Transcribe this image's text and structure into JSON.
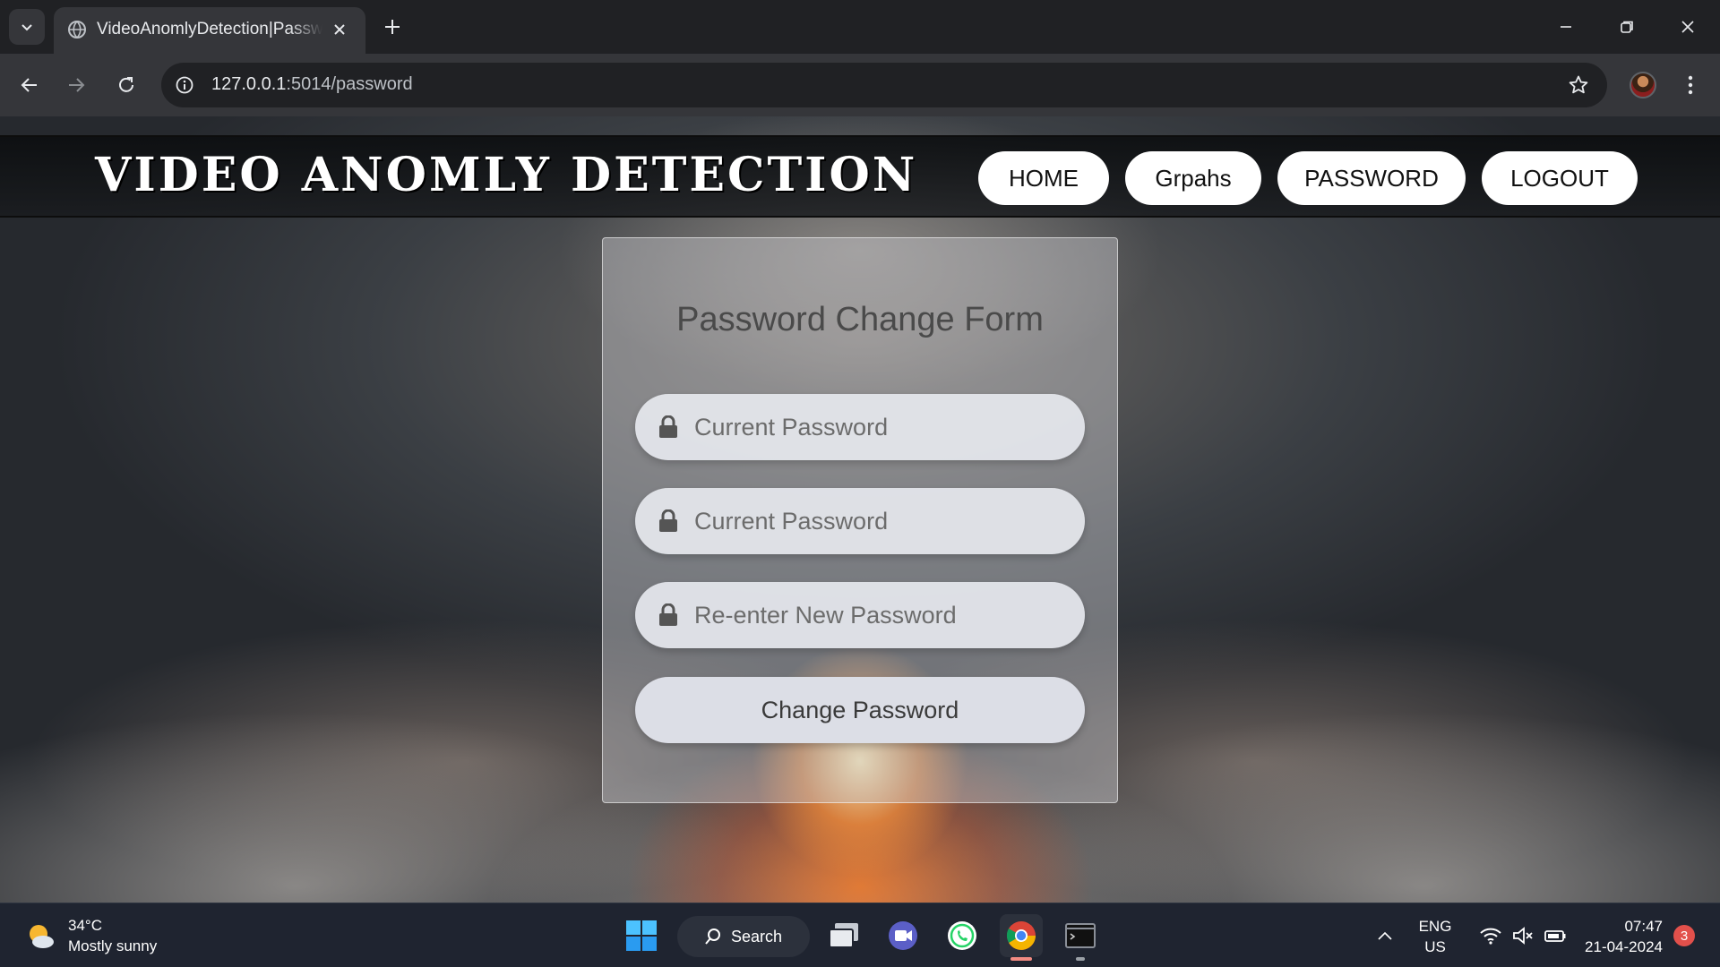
{
  "browser": {
    "tab_title": "VideoAnomlyDetection|Password",
    "url_host": "127.0.0.1",
    "url_path": ":5014/password"
  },
  "site": {
    "brand": "VIDEO ANOMLY DETECTION",
    "nav": [
      {
        "label": "HOME"
      },
      {
        "label": "Grpahs"
      },
      {
        "label": "PASSWORD"
      },
      {
        "label": "LOGOUT"
      }
    ]
  },
  "form": {
    "title": "Password Change Form",
    "fields": [
      {
        "placeholder": "Current Password",
        "icon": "lock-icon"
      },
      {
        "placeholder": "Current Password",
        "icon": "lock-icon"
      },
      {
        "placeholder": "Re-enter New Password",
        "icon": "lock-icon"
      }
    ],
    "submit_label": "Change Password"
  },
  "taskbar": {
    "weather_temp": "34°C",
    "weather_desc": "Mostly sunny",
    "search_label": "Search",
    "lang_primary": "ENG",
    "lang_secondary": "US",
    "time": "07:47",
    "date": "21-04-2024",
    "notification_count": "3"
  },
  "colors": {
    "chrome_dark": "#202124",
    "chrome_toolbar": "#35363a",
    "taskbar": "#1f2430",
    "nav_pill": "#ffffff"
  }
}
